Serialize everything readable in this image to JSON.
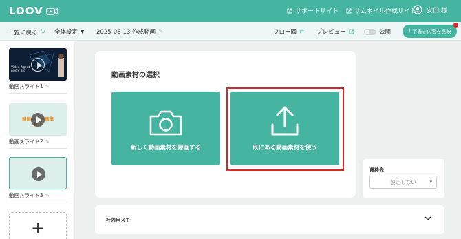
{
  "header": {
    "logo_text": "LOOV",
    "support_link": "サポートサイト",
    "thumbnail_link": "サムネイル作成サイト",
    "user_name": "安田 様"
  },
  "toolbar": {
    "back_label": "一覧に戻る",
    "settings_label": "全体設定",
    "project_title": "2025-08-13 作成動画",
    "flow_label": "フロー図",
    "preview_label": "プレビュー",
    "publish_label": "公開",
    "reflect_label": "下書き内容を反映"
  },
  "sidebar": {
    "slides": [
      {
        "label": "動画スライド1",
        "thumb_text": "Video Agent LOOV 3.0"
      },
      {
        "label": "動画スライド2",
        "thumb_text": "録画中 / 録画準備中"
      },
      {
        "label": "動画スライド3",
        "thumb_text": ""
      }
    ],
    "add_label": "+"
  },
  "main": {
    "section_title": "動画素材の選択",
    "record_new_label": "新しく動画素材を録画する",
    "use_existing_label": "既にある動画素材を使う"
  },
  "transition": {
    "title": "遷移先",
    "select_value": "設定しない"
  },
  "memo": {
    "title": "社内用メモ"
  },
  "colors": {
    "accent": "#45b5a2",
    "highlight": "#e02424"
  }
}
